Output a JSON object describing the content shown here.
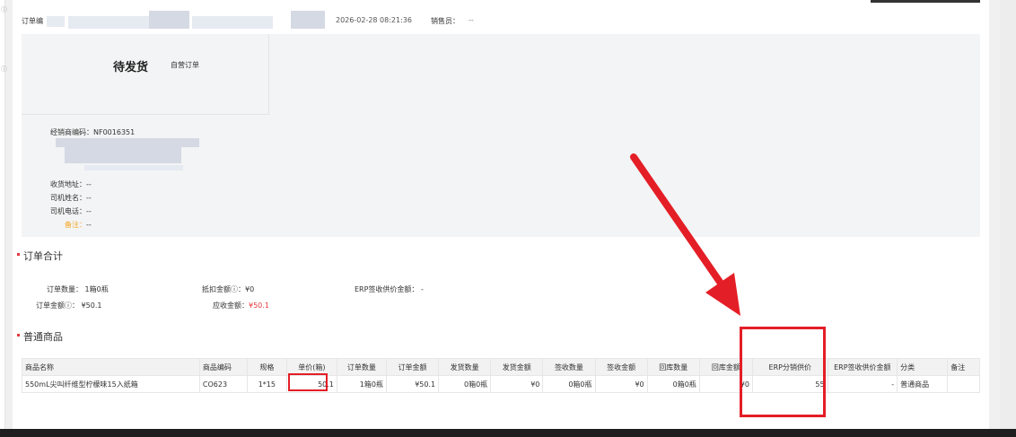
{
  "header": {
    "order_no_label": "订单编",
    "datetime": "2026-02-28 08:21:36",
    "sales_label": "销售员：",
    "sales_value": "--"
  },
  "status": {
    "title": "待发货",
    "tag": "自营订单"
  },
  "info": {
    "dealer_code_label": "经销商编码：",
    "dealer_code": "NF0016351",
    "address_label": "收货地址：",
    "address_value": "--",
    "driver_name_label": "司机姓名：",
    "driver_name_value": "--",
    "driver_phone_label": "司机电话：",
    "driver_phone_value": "--",
    "remark_label": "备注：",
    "remark_value": "--"
  },
  "summary": {
    "title": "订单合计",
    "qty_label": "订单数量：",
    "qty_value": "1箱0瓶",
    "deduct_label": "抵扣金额ⓘ：",
    "deduct_value": "¥0",
    "erp_sign_label": "ERP签收供价金额：",
    "erp_sign_value": "-",
    "amount_label": "订单金额ⓘ：",
    "amount_value": "¥50.1",
    "receivable_label": "应收金额：",
    "receivable_value": "¥50.1"
  },
  "goods": {
    "title": "普通商品",
    "columns": [
      "商品名称",
      "商品编码",
      "规格",
      "单价(箱)",
      "订单数量",
      "订单金额",
      "发货数量",
      "发货金额",
      "签收数量",
      "签收金额",
      "回库数量",
      "回库金额",
      "ERP分销供价",
      "ERP签收供价金额",
      "分类",
      "备注"
    ],
    "rows": [
      [
        "550mL尖叫纤维型柠檬味15入纸箱",
        "CO623",
        "1*15",
        "50.1",
        "1箱0瓶",
        "¥50.1",
        "0箱0瓶",
        "¥0",
        "0箱0瓶",
        "¥0",
        "0箱0瓶",
        "¥0",
        "55",
        "-",
        "普通商品",
        ""
      ]
    ]
  },
  "colors": {
    "annotation": "#e41e26",
    "accent_red": "#e4393c",
    "remark_orange": "#f5a623"
  }
}
